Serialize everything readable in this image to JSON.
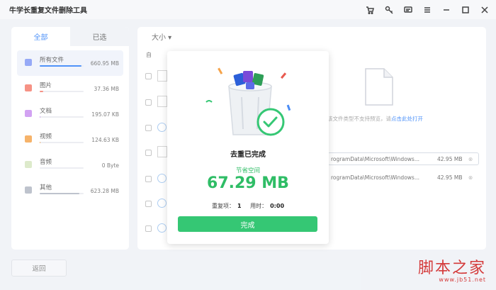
{
  "app": {
    "title": "牛学长重复文件删除工具",
    "toolbar_icons": [
      "cart-icon",
      "key-icon",
      "feedback-icon",
      "menu-icon",
      "minimize-icon",
      "maximize-icon",
      "close-icon"
    ]
  },
  "left_panel": {
    "tabs": [
      "全部",
      "已选"
    ],
    "categories": [
      {
        "name": "所有文件",
        "size": "660.95 MB",
        "color": "#7f96f5",
        "fill": 0.95,
        "selected": true
      },
      {
        "name": "图片",
        "size": "37.36 MB",
        "color": "#f47b6b",
        "fill": 0.08,
        "selected": false
      },
      {
        "name": "文档",
        "size": "195.07 KB",
        "color": "#c88ef0",
        "fill": 0.02,
        "selected": false
      },
      {
        "name": "视频",
        "size": "124.63 KB",
        "color": "#f5a34a",
        "fill": 0.02,
        "selected": false
      },
      {
        "name": "音频",
        "size": "0 Byte",
        "color": "#d6e6c0",
        "fill": 0.0,
        "selected": false
      },
      {
        "name": "其他",
        "size": "623.28 MB",
        "color": "#b0b6c2",
        "fill": 0.9,
        "selected": false
      }
    ],
    "back_label": "返回"
  },
  "main": {
    "sort_label": "大小 ▾",
    "list_header": "自",
    "preview_message": "该文件类型不支持预览，请",
    "preview_link": "点击此处打开",
    "paths": [
      {
        "path": "rogramData\\Microsoft\\Windows...",
        "size": "42.95 MB"
      },
      {
        "path": "rogramData\\Microsoft\\Windows...",
        "size": "42.95 MB"
      }
    ]
  },
  "dialog": {
    "title": "去重已完成",
    "saved_label": "节省空间",
    "saved_value": "67.29 MB",
    "dup_label": "重复项：",
    "dup_value": "1",
    "time_label": "用时：",
    "time_value": "0:00",
    "done_label": "完成"
  },
  "watermark": {
    "title": "脚本之家",
    "url": "www.jb51.net"
  },
  "colors": {
    "accent": "#2a7cf8",
    "success": "#35c774",
    "watermark": "#d43a3a"
  }
}
